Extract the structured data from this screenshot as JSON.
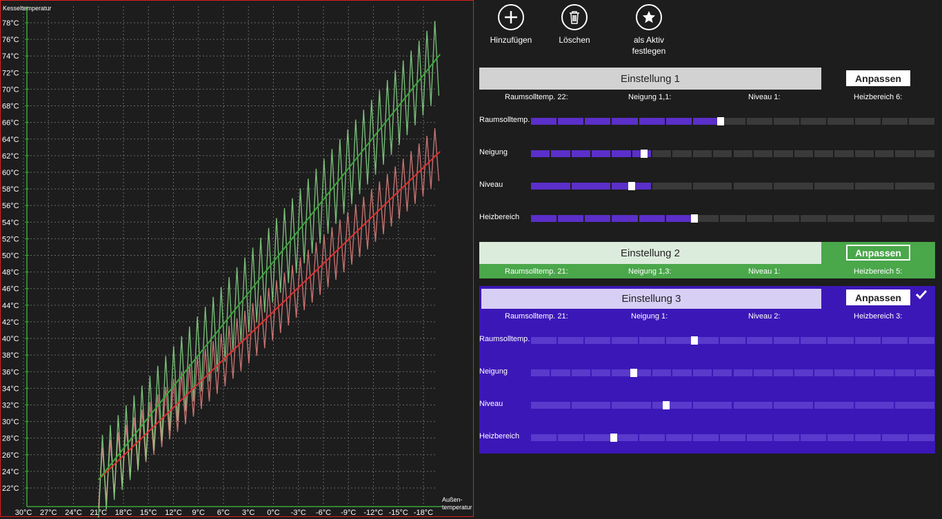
{
  "chart_data": {
    "type": "line",
    "ylabel": "Kesseltemperatur",
    "xlabel": "Außen-\ntemperatur",
    "y_ticks": [
      "78°C",
      "76°C",
      "74°C",
      "72°C",
      "70°C",
      "68°C",
      "66°C",
      "64°C",
      "62°C",
      "60°C",
      "58°C",
      "56°C",
      "54°C",
      "52°C",
      "50°C",
      "48°C",
      "46°C",
      "44°C",
      "42°C",
      "40°C",
      "38°C",
      "36°C",
      "34°C",
      "32°C",
      "30°C",
      "28°C",
      "26°C",
      "24°C",
      "22°C"
    ],
    "x_ticks": [
      "30°C",
      "27°C",
      "24°C",
      "21°C",
      "18°C",
      "15°C",
      "12°C",
      "9°C",
      "6°C",
      "3°C",
      "0°C",
      "-3°C",
      "-6°C",
      "-9°C",
      "-12°C",
      "-15°C",
      "-18°C"
    ],
    "ylim": [
      20.5,
      80
    ],
    "xlim": [
      30,
      -20
    ],
    "grid": true,
    "series": [
      {
        "color": "#e03030",
        "x": [
          21,
          -20
        ],
        "y": [
          23,
          62.5
        ]
      },
      {
        "color": "#3aa83a",
        "x": [
          21,
          -20
        ],
        "y": [
          23,
          74.2
        ]
      }
    ],
    "envelopes": [
      {
        "color": "#e08080",
        "x": [
          21,
          -20
        ],
        "center": [
          23,
          62.5
        ],
        "amplitude": 3.4,
        "period": 0.95
      },
      {
        "color": "#88d888",
        "x": [
          21,
          -20
        ],
        "center": [
          23,
          74.2
        ],
        "amplitude": 4.8,
        "period": 0.95
      }
    ]
  },
  "commands": {
    "add": {
      "label": "Hinzufügen",
      "icon": "plus-icon"
    },
    "delete": {
      "label": "Löschen",
      "icon": "trash-icon"
    },
    "activate": {
      "label": "als Aktiv\nfestlegen",
      "icon": "star-icon"
    }
  },
  "settings": [
    {
      "title": "Einstellung 1",
      "adjust": "Anpassen",
      "summary": [
        "Raumsolltemp. 22:",
        "Neigung 1,1:",
        "Niveau 1:",
        "Heizbereich 6:"
      ],
      "bg": "#1d1d1d",
      "title_bg": "#d2d2d2",
      "seg_on": "#5b2fc9",
      "seg_off": "#3a3a3a",
      "sliders": [
        {
          "label": "Raumsolltemp.",
          "steps": 15,
          "value": 0.47
        },
        {
          "label": "Neigung",
          "steps": 20,
          "value": 0.28
        },
        {
          "label": "Niveau",
          "steps": 10,
          "value": 0.25
        },
        {
          "label": "Heizbereich",
          "steps": 15,
          "value": 0.405
        }
      ]
    },
    {
      "title": "Einstellung 2",
      "adjust": "Anpassen",
      "summary": [
        "Raumsolltemp. 21:",
        "Neigung 1,3:",
        "Niveau 1:",
        "Heizbereich 5:"
      ],
      "bg": "#4aa74a",
      "title_bg": "#dcecdc"
    },
    {
      "title": "Einstellung 3",
      "adjust": "Anpassen",
      "active": true,
      "summary": [
        "Raumsolltemp. 21:",
        "Neigung 1:",
        "Niveau 2:",
        "Heizbereich 3:"
      ],
      "bg": "#3c17b8",
      "title_bg": "#d8cff5",
      "seg_on": "#5a3acc",
      "seg_off": "#5a3acc",
      "sliders": [
        {
          "label": "Raumsolltemp.",
          "steps": 15,
          "value": 0.405
        },
        {
          "label": "Neigung",
          "steps": 20,
          "value": 0.255
        },
        {
          "label": "Niveau",
          "steps": 10,
          "value": 0.335
        },
        {
          "label": "Heizbereich",
          "steps": 15,
          "value": 0.205
        }
      ]
    }
  ]
}
